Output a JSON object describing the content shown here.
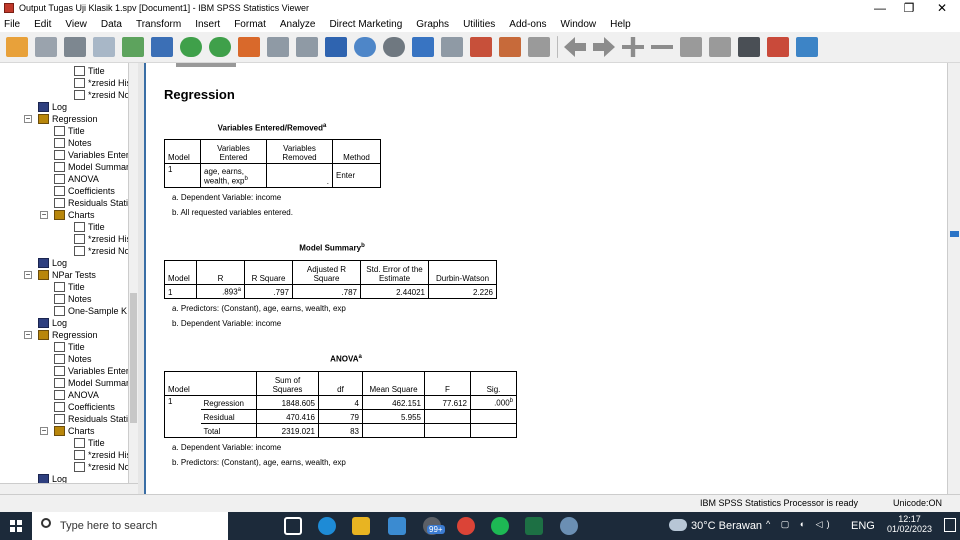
{
  "window": {
    "title": "Output Tugas Uji Klasik 1.spv [Document1] - IBM SPSS Statistics Viewer",
    "minimize": "—",
    "restore": "❐",
    "close": "✕"
  },
  "menu": [
    "File",
    "Edit",
    "View",
    "Data",
    "Transform",
    "Insert",
    "Format",
    "Analyze",
    "Direct Marketing",
    "Graphs",
    "Utilities",
    "Add-ons",
    "Window",
    "Help"
  ],
  "toolbar": [
    "open-icon",
    "save-icon",
    "print-icon",
    "print-preview-icon",
    "export-icon",
    "recall-dialog-icon",
    "undo-icon",
    "redo-icon",
    "goto-data-icon",
    "goto-case-icon",
    "goto-variable-icon",
    "variables-icon",
    "select-output-icon",
    "show-all-icon",
    "insert-heading-icon",
    "insert-title-icon",
    "insert-text-icon",
    "insert-chart-icon",
    "designate-window-icon",
    "back-icon",
    "forward-icon",
    "expand-icon",
    "collapse-icon",
    "show-icon",
    "hide-icon",
    "insert-new-title-icon",
    "insert-new-text-icon",
    "insert-image-icon"
  ],
  "tree": [
    {
      "label": "Title",
      "icon": "title-icon"
    },
    {
      "label": "*zresid His",
      "icon": "chart-icon"
    },
    {
      "label": "*zresid No",
      "icon": "chart-icon"
    },
    {
      "label": "Log",
      "icon": "log-icon"
    },
    {
      "label": "Regression",
      "icon": "book-icon"
    },
    {
      "label": "Title",
      "icon": "title-icon"
    },
    {
      "label": "Notes",
      "icon": "notes-icon"
    },
    {
      "label": "Variables Enter",
      "icon": "table-icon"
    },
    {
      "label": "Model Summar",
      "icon": "table-icon"
    },
    {
      "label": "ANOVA",
      "icon": "table-icon"
    },
    {
      "label": "Coefficients",
      "icon": "table-icon"
    },
    {
      "label": "Residuals Stati",
      "icon": "table-icon"
    },
    {
      "label": "Charts",
      "icon": "book-icon"
    },
    {
      "label": "Title",
      "icon": "title-icon"
    },
    {
      "label": "*zresid His",
      "icon": "chart-icon"
    },
    {
      "label": "*zresid No",
      "icon": "chart-icon"
    },
    {
      "label": "Log",
      "icon": "log-icon"
    },
    {
      "label": "NPar Tests",
      "icon": "book-icon"
    },
    {
      "label": "Title",
      "icon": "title-icon"
    },
    {
      "label": "Notes",
      "icon": "notes-icon"
    },
    {
      "label": "One-Sample K",
      "icon": "table-icon"
    },
    {
      "label": "Log",
      "icon": "log-icon"
    },
    {
      "label": "Regression",
      "icon": "book-icon"
    },
    {
      "label": "Title",
      "icon": "title-icon"
    },
    {
      "label": "Notes",
      "icon": "notes-icon"
    },
    {
      "label": "Variables Enter",
      "icon": "table-icon"
    },
    {
      "label": "Model Summar",
      "icon": "table-icon"
    },
    {
      "label": "ANOVA",
      "icon": "table-icon"
    },
    {
      "label": "Coefficients",
      "icon": "table-icon"
    },
    {
      "label": "Residuals Stati",
      "icon": "table-icon"
    },
    {
      "label": "Charts",
      "icon": "book-icon"
    },
    {
      "label": "Title",
      "icon": "title-icon"
    },
    {
      "label": "*zresid His",
      "icon": "chart-icon"
    },
    {
      "label": "*zresid No",
      "icon": "chart-icon"
    },
    {
      "label": "Log",
      "icon": "log-icon"
    }
  ],
  "output": {
    "heading": "Regression",
    "ver": {
      "caption": "Variables Entered/Removed",
      "caption_sup": "a",
      "headers": [
        "Model",
        "Variables Entered",
        "Variables Removed",
        "Method"
      ],
      "row": {
        "model": "1",
        "entered": "age, earns, wealth, exp",
        "entered_sup": "b",
        "removed": ".",
        "method": "Enter"
      },
      "notes": [
        "a. Dependent Variable: income",
        "b. All requested variables entered."
      ]
    },
    "ms": {
      "caption": "Model Summary",
      "caption_sup": "b",
      "headers": [
        "Model",
        "R",
        "R Square",
        "Adjusted R Square",
        "Std. Error of the Estimate",
        "Durbin-Watson"
      ],
      "row": {
        "model": "1",
        "r": ".893",
        "r_sup": "a",
        "rsq": ".797",
        "adj": ".787",
        "se": "2.44021",
        "dw": "2.226"
      },
      "notes": [
        "a. Predictors: (Constant), age, earns, wealth, exp",
        "b. Dependent Variable: income"
      ]
    },
    "anova": {
      "caption": "ANOVA",
      "caption_sup": "a",
      "headers": [
        "Model",
        "",
        "Sum of Squares",
        "df",
        "Mean Square",
        "F",
        "Sig."
      ],
      "model": "1",
      "rows": [
        {
          "name": "Regression",
          "ss": "1848.605",
          "df": "4",
          "ms": "462.151",
          "f": "77.612",
          "sig": ".000",
          "sig_sup": "b"
        },
        {
          "name": "Residual",
          "ss": "470.416",
          "df": "79",
          "ms": "5.955",
          "f": "",
          "sig": ""
        },
        {
          "name": "Total",
          "ss": "2319.021",
          "df": "83",
          "ms": "",
          "f": "",
          "sig": ""
        }
      ],
      "notes": [
        "a. Dependent Variable: income",
        "b. Predictors: (Constant), age, earns, wealth, exp"
      ]
    }
  },
  "status": {
    "processor": "IBM SPSS Statistics Processor is ready",
    "unicode": "Unicode:ON"
  },
  "taskbar": {
    "search_placeholder": "Type here to search",
    "weather": "30°C  Berawan",
    "lang": "ENG",
    "time": "12:17",
    "date": "01/02/2023",
    "badge": "99+"
  }
}
